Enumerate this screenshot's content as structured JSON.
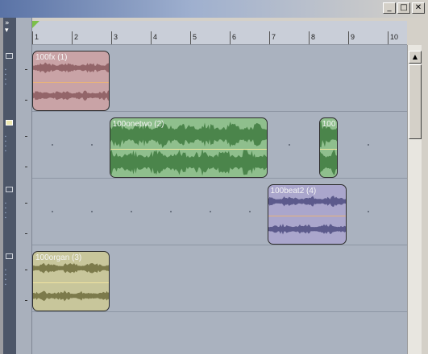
{
  "window": {
    "minimize_glyph": "_",
    "maximize_glyph": "□",
    "close_glyph": "✕"
  },
  "toolbar": {
    "expand_glyph": "»"
  },
  "ruler": {
    "ticks": [
      "1",
      "2",
      "3",
      "4",
      "5",
      "6",
      "7",
      "8",
      "9",
      "10"
    ]
  },
  "tracks": [
    {
      "name": "track-1",
      "selected": false
    },
    {
      "name": "track-2",
      "selected": true
    },
    {
      "name": "track-3",
      "selected": false
    },
    {
      "name": "track-4",
      "selected": false
    }
  ],
  "clips": [
    {
      "id": "clip-100fx",
      "label": "100fx (1)",
      "track": 0,
      "start": 1.0,
      "end": 2.95,
      "fill": "#c9a3a6",
      "wave": "#8a5b5e",
      "mid": "#e8b37a"
    },
    {
      "id": "clip-100onetwo",
      "label": "100onetwo (2)",
      "track": 1,
      "start": 2.95,
      "end": 6.95,
      "fill": "#8fbf8d",
      "wave": "#3f7a3f",
      "mid": "#efe6a0"
    },
    {
      "id": "clip-100onetwo-b",
      "label": "100",
      "track": 1,
      "start": 8.26,
      "end": 8.74,
      "fill": "#8fbf8d",
      "wave": "#3f7a3f",
      "mid": "#efe6a0"
    },
    {
      "id": "clip-100beat2",
      "label": "100beat2 (4)",
      "track": 2,
      "start": 6.95,
      "end": 8.95,
      "fill": "#aaa6cc",
      "wave": "#4f4c80",
      "mid": "#e8b37a"
    },
    {
      "id": "clip-100organ",
      "label": "100organ (3)",
      "track": 3,
      "start": 1.0,
      "end": 2.95,
      "fill": "#c8c69b",
      "wave": "#6e6c3d",
      "mid": "#f0e2a0"
    }
  ],
  "colors": {
    "timeline_bg": "#aab2bf",
    "ruler_bg": "#c9ced8",
    "track_header_bg": "#4d5668"
  }
}
